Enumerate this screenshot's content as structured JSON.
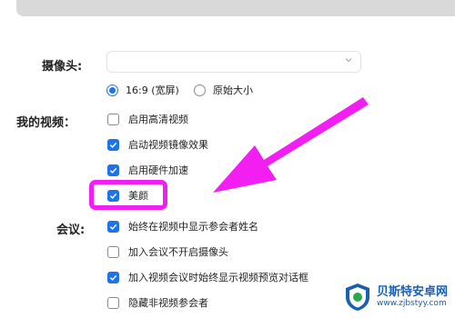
{
  "camera": {
    "label": "摄像头:",
    "dropdown_value": "",
    "ratio_options": [
      {
        "label": "16:9 (宽屏)",
        "selected": true
      },
      {
        "label": "原始大小",
        "selected": false
      }
    ]
  },
  "my_video": {
    "label": "我的视频：",
    "options": [
      {
        "label": "启用高清视频",
        "checked": false
      },
      {
        "label": "启动视频镜像效果",
        "checked": true
      },
      {
        "label": "启用硬件加速",
        "checked": true
      },
      {
        "label": "美颜",
        "checked": true
      }
    ]
  },
  "meeting": {
    "label": "会议:",
    "options": [
      {
        "label": "始终在视频中显示参会者姓名",
        "checked": true
      },
      {
        "label": "加入会议不开启摄像头",
        "checked": false
      },
      {
        "label": "加入视频会议时始终显示视频预览对话框",
        "checked": true
      },
      {
        "label": "隐藏非视频参会者",
        "checked": false
      }
    ]
  },
  "watermark": {
    "title": "贝斯特安卓网",
    "url": "www.zjbstyy.com"
  },
  "colors": {
    "accent": "#1e73e8",
    "highlight": "#f21ef2"
  }
}
